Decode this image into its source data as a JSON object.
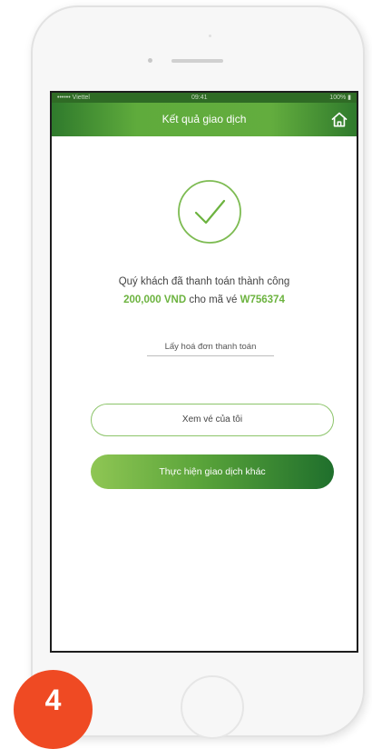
{
  "status_bar": {
    "left": "•••••• Viettel  ",
    "time": "09:41",
    "right": "100% ▮"
  },
  "header": {
    "title": "Kết quả giao dịch",
    "home_icon": "home-icon"
  },
  "result": {
    "icon": "check-circle-icon",
    "message_line1": "Quý khách đã thanh toán thành công",
    "amount": "200,000 VND",
    "middle_text": " cho mã vé ",
    "ticket_code": "W756374"
  },
  "actions": {
    "invoice_link": "Lấy hoá đơn thanh toán",
    "view_tickets_button": "Xem vé của tôi",
    "new_transaction_button": "Thực hiện giao dịch khác"
  },
  "step_badge": "4",
  "colors": {
    "brand_green": "#6cb33f",
    "dark_green": "#1f6f2c",
    "badge_orange": "#ef4a23"
  }
}
